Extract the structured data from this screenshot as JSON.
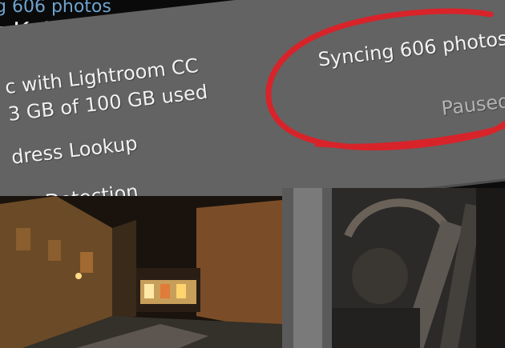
{
  "header": {
    "sync_status": "g 606 photos",
    "user_name": "t Kelby"
  },
  "panel": {
    "sync_title": "c with Lightroom CC",
    "storage": "3 GB of 100 GB used",
    "address_lookup": "dress Lookup",
    "face_detection": "ce Detection",
    "sync_count": "Syncing 606 photos",
    "sync_state": "Paused"
  },
  "colors": {
    "accent_blue": "#6ea3cf",
    "annotation_red": "#d8232a",
    "panel_grey": "#636363"
  }
}
